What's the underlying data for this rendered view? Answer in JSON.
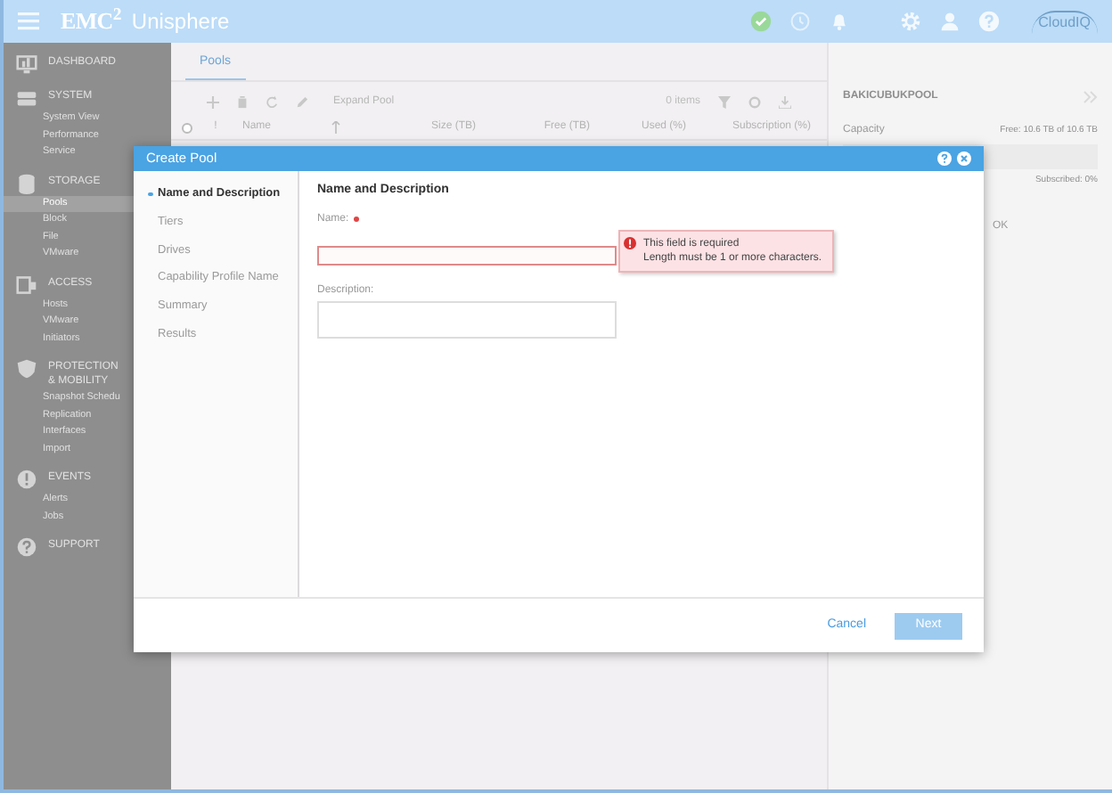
{
  "header": {
    "logo": "EMC$^{2}$",
    "product": "Unisphere",
    "cloud_logo": "CloudIQ"
  },
  "sidebar": {
    "sections": [
      {
        "label": "DASHBOARD"
      },
      {
        "label": "SYSTEM",
        "items": [
          {
            "label": "System View",
            "selected": false
          },
          {
            "label": "Performance",
            "selected": false
          },
          {
            "label": "Service",
            "selected": false
          }
        ]
      },
      {
        "label": "STORAGE",
        "items": [
          {
            "label": "Pools",
            "selected": true
          },
          {
            "label": "Block",
            "selected": false
          },
          {
            "label": "File",
            "selected": false
          },
          {
            "label": "VMware",
            "selected": false
          }
        ]
      },
      {
        "label": "ACCESS",
        "items": [
          {
            "label": "Hosts",
            "selected": false
          },
          {
            "label": "VMware",
            "selected": false
          },
          {
            "label": "Initiators",
            "selected": false
          }
        ]
      },
      {
        "label": "PROTECTION & MOBILITY",
        "items": [
          {
            "label": "Snapshot Schedu",
            "selected": false
          },
          {
            "label": "Replication",
            "selected": false
          },
          {
            "label": "Interfaces",
            "selected": false
          },
          {
            "label": "Import",
            "selected": false
          }
        ]
      },
      {
        "label": "EVENTS",
        "items": [
          {
            "label": "Alerts",
            "selected": false
          },
          {
            "label": "Jobs",
            "selected": false
          }
        ]
      },
      {
        "label": "SUPPORT"
      }
    ]
  },
  "tabs": [
    {
      "label": "Pools",
      "selected": true
    }
  ],
  "toolbar": {
    "expand_label": "Expand Pool",
    "count": "0 items"
  },
  "table": {
    "select_all_checked": false,
    "columns": [
      "!",
      "Name",
      "Size (TB)",
      "Free (TB)",
      "Used (%)",
      "Subscription (%)"
    ]
  },
  "details": {
    "title": "BAKICUBUKPOOL",
    "capacity_label": "Capacity",
    "capacity_reading": "Free: 10.6 TB of 10.6 TB",
    "level": 0,
    "subscribed": "Subscribed: 0%",
    "health": "OK"
  },
  "dialog": {
    "title": "Create Pool",
    "steps": [
      {
        "label": "Name and Description",
        "selected": true
      },
      {
        "label": "Tiers",
        "selected": false
      },
      {
        "label": "Drives",
        "selected": false
      },
      {
        "label": "Capability Profile Name",
        "selected": false
      },
      {
        "label": "Summary",
        "selected": false
      },
      {
        "label": "Results",
        "selected": false
      }
    ],
    "section_title": "Name and Description",
    "name_field": {
      "label": "Name:",
      "required": true,
      "error": [
        "This field is required",
        "Length must be 1 or more characters."
      ]
    },
    "description_field": {
      "label": "Description:"
    },
    "buttons": {
      "cancel": "Cancel",
      "next": {
        "label": "Next",
        "disabled": true
      }
    }
  }
}
